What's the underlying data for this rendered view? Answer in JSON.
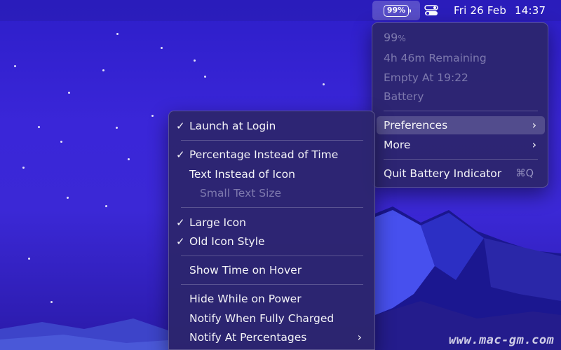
{
  "menubar": {
    "battery_percent": "99%",
    "date": "Fri 26 Feb",
    "time": "14:37"
  },
  "battery_menu": {
    "info": {
      "percent": "99",
      "percent_sign": "%",
      "remaining": "4h 46m Remaining",
      "empty_at": "Empty At 19:22",
      "source": "Battery"
    },
    "items": [
      {
        "label": "Preferences",
        "has_submenu": true,
        "highlighted": true
      },
      {
        "label": "More",
        "has_submenu": true
      },
      {
        "label": "Quit Battery Indicator",
        "shortcut": "⌘Q"
      }
    ]
  },
  "preferences_menu": {
    "items": [
      {
        "label": "Launch at Login",
        "checked": true
      },
      {
        "label": "Percentage Instead of Time",
        "checked": true
      },
      {
        "label": "Text Instead of Icon",
        "checked": false
      },
      {
        "label": "Small Text Size",
        "checked": false,
        "disabled": true
      },
      {
        "label": "Large Icon",
        "checked": true
      },
      {
        "label": "Old Icon Style",
        "checked": true
      },
      {
        "label": "Show Time on Hover",
        "checked": false
      },
      {
        "label": "Hide While on Power",
        "checked": false
      },
      {
        "label": "Notify When Fully Charged",
        "checked": false
      },
      {
        "label": "Notify At Percentages",
        "checked": false,
        "has_submenu": true
      }
    ],
    "check_glyph": "✓",
    "chevron_glyph": "›"
  },
  "watermark": "www.mac-gm.com",
  "icons": {
    "battery": "battery-icon",
    "control_center": "control-center-icon",
    "submenu_arrow": "chevron-right-icon"
  }
}
